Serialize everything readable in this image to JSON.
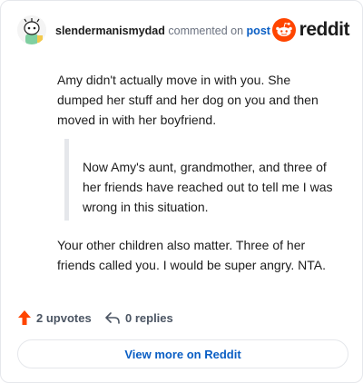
{
  "header": {
    "username": "slendermanismydad",
    "action_text": "commented on",
    "post_link": "post",
    "brand_name": "reddit"
  },
  "comment": {
    "paragraph1": "Amy didn't actually move in with you. She dumped her stuff and her dog on you and then moved in with her boyfriend.",
    "quote": "Now Amy's aunt, grandmother, and three of her friends have reached out to tell me I was wrong in this situation.",
    "paragraph2": "Your other children also matter. Three of her friends called you. I would be super angry. NTA."
  },
  "actions": {
    "upvotes": "2 upvotes",
    "replies": "0 replies"
  },
  "cta": {
    "label": "View more on Reddit"
  },
  "colors": {
    "brand_orange": "#ff4500",
    "link_blue": "#0a5ec4"
  }
}
